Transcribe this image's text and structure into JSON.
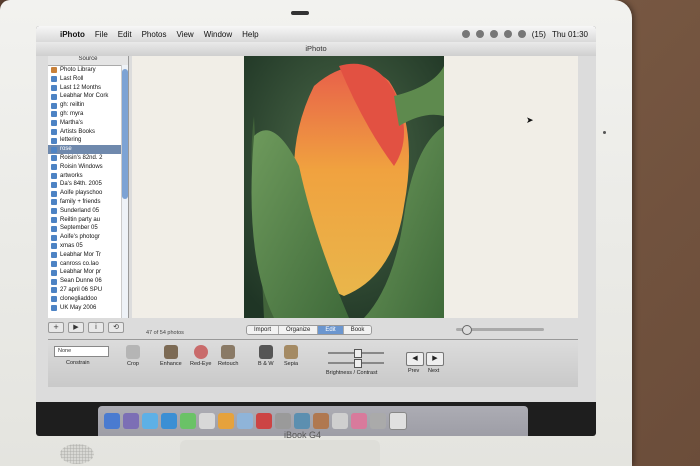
{
  "device": {
    "brand": "iBook G4"
  },
  "menubar": {
    "app_name": "iPhoto",
    "items": [
      "File",
      "Edit",
      "Photos",
      "View",
      "Window",
      "Help"
    ],
    "battery": "(15)",
    "clock": "Thu 01:30"
  },
  "window": {
    "title": "iPhoto"
  },
  "sidebar": {
    "header": "Source",
    "items": [
      {
        "label": "Photo Library"
      },
      {
        "label": "Last Roll"
      },
      {
        "label": "Last 12 Months"
      },
      {
        "label": "Leabhar Mor Cork"
      },
      {
        "label": "gh: reiltin"
      },
      {
        "label": "gh: myra"
      },
      {
        "label": "Martha's"
      },
      {
        "label": "Artists Books"
      },
      {
        "label": "lettering"
      },
      {
        "label": "rose"
      },
      {
        "label": "Roisin's 82nd. 2"
      },
      {
        "label": "Roisin Windows"
      },
      {
        "label": "artworks"
      },
      {
        "label": "Da's 84th. 2005"
      },
      {
        "label": "Aoife playschoo"
      },
      {
        "label": "family + friends"
      },
      {
        "label": "Sunderland 05"
      },
      {
        "label": "Reiltin party au"
      },
      {
        "label": "September 05"
      },
      {
        "label": "Aoife's photogr"
      },
      {
        "label": "xmas 05"
      },
      {
        "label": "Leabhar Mor Tr"
      },
      {
        "label": "canross co.lao"
      },
      {
        "label": "Leabhar Mor pr"
      },
      {
        "label": "Sean Dunne 06"
      },
      {
        "label": "27 april 06 SPU"
      },
      {
        "label": "clonegliaddoo"
      },
      {
        "label": "UK May 2006"
      }
    ],
    "selected_index": 9,
    "tools": [
      "+",
      "▶",
      "i",
      "⟲"
    ]
  },
  "status": {
    "photo_count": "47 of 54 photos"
  },
  "modes": {
    "tabs": [
      "Import",
      "Organize",
      "Edit",
      "Book"
    ],
    "active": "Edit"
  },
  "edit_toolbar": {
    "constrain_value": "None",
    "constrain_label": "Constrain",
    "tools": [
      "Crop",
      "Enhance",
      "Red-Eye",
      "Retouch",
      "B & W",
      "Sepia"
    ],
    "brightness_contrast_label": "Brightness / Contrast",
    "prev_label": "Prev",
    "next_label": "Next"
  },
  "zoom": {
    "level": 0.08
  },
  "colors": {
    "selection": "#6f89ad",
    "active_tab": "#6b96cf",
    "album_icon": "#4d83c4",
    "library_icon": "#c8813a"
  }
}
